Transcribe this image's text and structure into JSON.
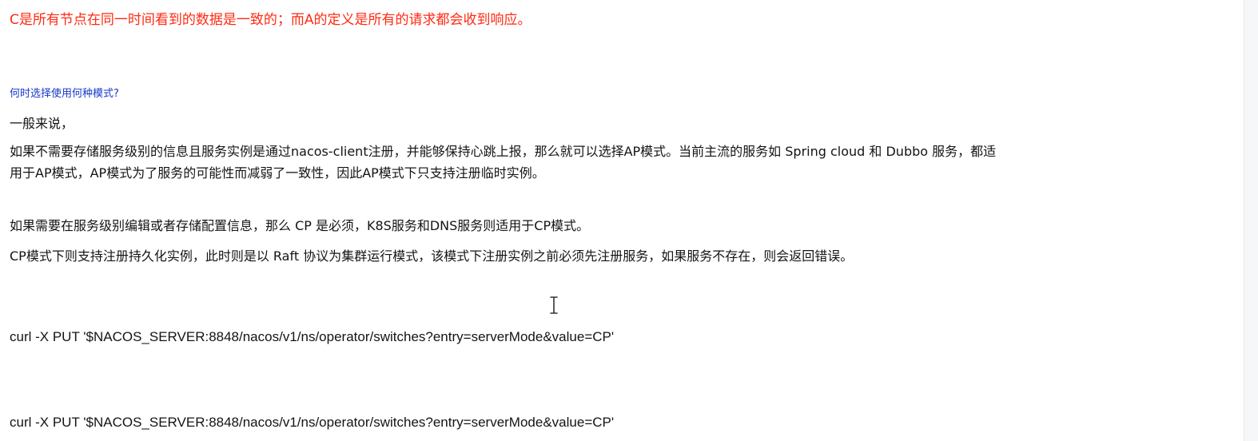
{
  "document": {
    "definition_line": "C是所有节点在同一时间看到的数据是一致的；而A的定义是所有的请求都会收到响应。",
    "question_heading": "何时选择使用何种模式?",
    "general_intro": "一般来说，",
    "ap_paragraph_line1": "如果不需要存储服务级别的信息且服务实例是通过nacos-client注册，并能够保持心跳上报，那么就可以选择AP模式。当前主流的服务如 Spring cloud 和 Dubbo 服务，都适",
    "ap_paragraph_line2": "用于AP模式，AP模式为了服务的可能性而减弱了一致性，因此AP模式下只支持注册临时实例。",
    "cp_paragraph_line1": "如果需要在服务级别编辑或者存储配置信息，那么 CP 是必须，K8S服务和DNS服务则适用于CP模式。",
    "cp_paragraph_line2": "CP模式下则支持注册持久化实例，此时则是以 Raft 协议为集群运行模式，该模式下注册实例之前必须先注册服务，如果服务不存在，则会返回错误。",
    "curl_command_1": "curl -X PUT '$NACOS_SERVER:8848/nacos/v1/ns/operator/switches?entry=serverMode&value=CP'",
    "curl_command_2": "curl -X PUT '$NACOS_SERVER:8848/nacos/v1/ns/operator/switches?entry=serverMode&value=CP'"
  },
  "colors": {
    "definition_text": "#ff2a12",
    "heading_text": "#1638c9",
    "body_text": "#141414",
    "background": "#ffffff"
  },
  "icons": {
    "cursor": "text-cursor-icon"
  }
}
